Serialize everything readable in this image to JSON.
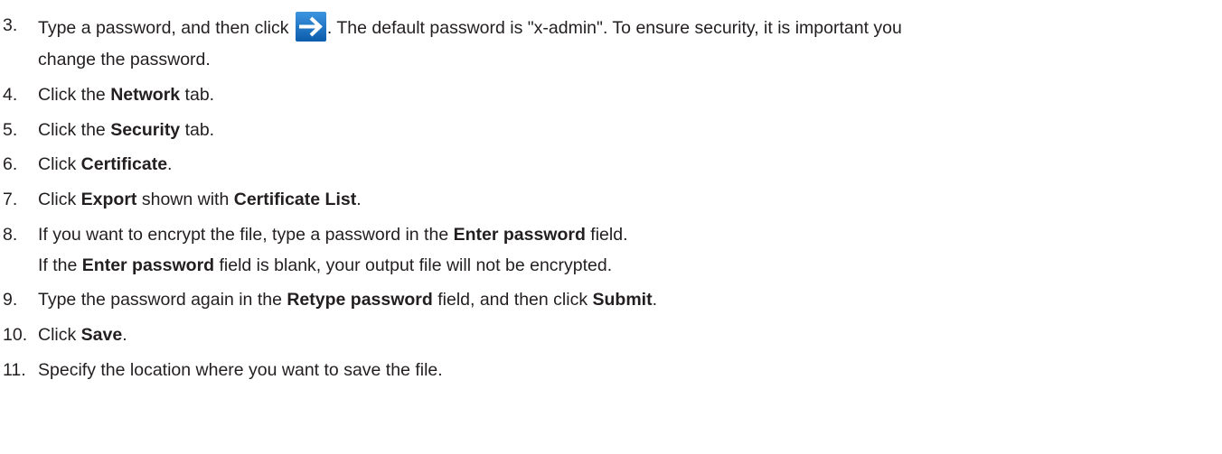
{
  "steps": [
    {
      "number": "3.",
      "line1": {
        "t1": "Type a password, and then click ",
        "icon": "arrow-right-icon",
        "t2": ". The default password is \"x-admin\". To ensure security, it is important you"
      },
      "line2": "change the password."
    },
    {
      "number": "4.",
      "pre": "Click the ",
      "bold": "Network",
      "post": " tab."
    },
    {
      "number": "5.",
      "pre": "Click the ",
      "bold": "Security",
      "post": " tab."
    },
    {
      "number": "6.",
      "pre": "Click ",
      "bold": "Certificate",
      "post": "."
    },
    {
      "number": "7.",
      "pre": "Click ",
      "bold1": "Export",
      "mid": " shown with ",
      "bold2": "Certificate List",
      "post": "."
    },
    {
      "number": "8.",
      "line1": {
        "pre": "If you want to encrypt the file, type a password in the ",
        "bold": "Enter password",
        "post": " field."
      },
      "line2": {
        "pre": "If the ",
        "bold": "Enter password",
        "post": " field is blank, your output file will not be encrypted."
      }
    },
    {
      "number": "9.",
      "pre": "Type the password again in the ",
      "bold1": "Retype password",
      "mid": " field, and then click ",
      "bold2": "Submit",
      "post": "."
    },
    {
      "number": "10.",
      "pre": "Click ",
      "bold": "Save",
      "post": "."
    },
    {
      "number": "11.",
      "text": "Specify the location where you want to save the file."
    }
  ],
  "colors": {
    "text": "#231f20",
    "icon_blue": "#1a73c8",
    "icon_arrow": "#ffffff"
  }
}
